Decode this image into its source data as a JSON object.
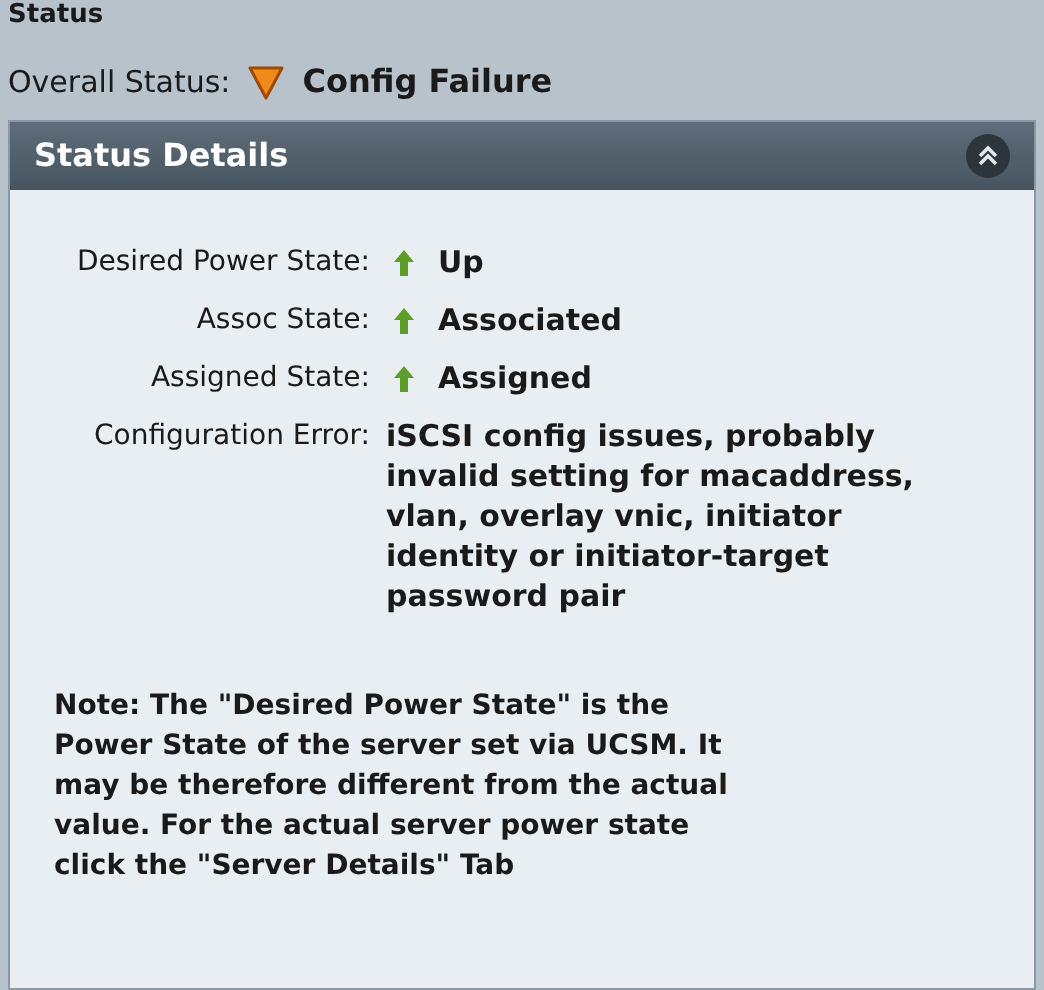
{
  "section_title": "Status",
  "overall_status": {
    "label": "Overall Status:",
    "value": "Config Failure"
  },
  "panel": {
    "title": "Status Details",
    "expanded": true,
    "rows": [
      {
        "label": "Desired Power State:",
        "value": "Up",
        "kind": "state"
      },
      {
        "label": "Assoc State:",
        "value": "Associated",
        "kind": "state"
      },
      {
        "label": "Assigned State:",
        "value": "Assigned",
        "kind": "state"
      },
      {
        "label": "Configuration Error:",
        "value": "iSCSI config issues, probably invalid setting for macaddress, vlan, overlay vnic, initiator identity or initiator-target password pair",
        "kind": "text"
      }
    ],
    "note": "Note: The \"Desired Power State\" is the Power State of the server set via UCSM. It may be therefore different from the actual value. For the actual server power state click the \"Server Details\" Tab"
  }
}
